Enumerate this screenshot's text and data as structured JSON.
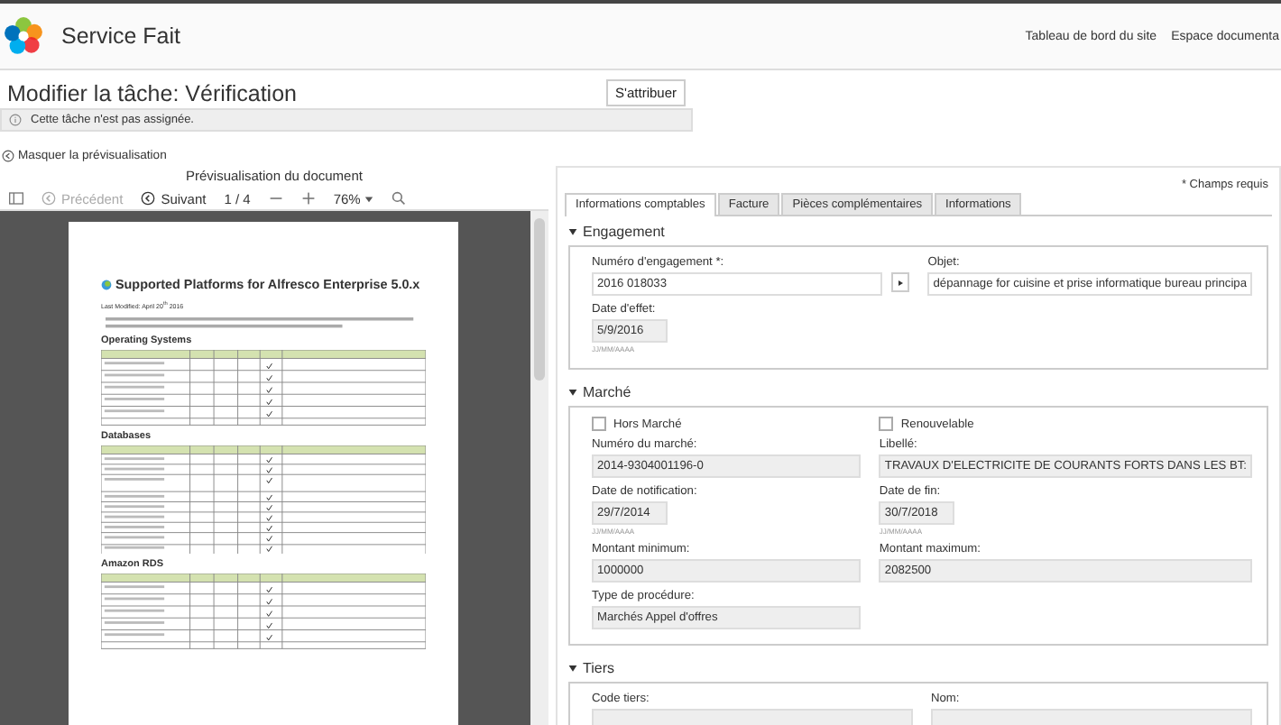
{
  "header": {
    "title": "Service Fait",
    "nav": [
      "Tableau de bord du site",
      "Espace documenta"
    ]
  },
  "task": {
    "title": "Modifier la tâche: Vérification",
    "assign_button": "S'attribuer",
    "notice": "Cette tâche n'est pas assignée."
  },
  "preview_toggle": "Masquer la prévisualisation",
  "preview": {
    "title": "Prévisualisation du document",
    "toolbar": {
      "previous": {
        "label": "Précédent",
        "disabled": true
      },
      "next": {
        "label": "Suivant",
        "disabled": false
      },
      "page": "1 / 4",
      "zoom": "76%"
    },
    "document": {
      "title": "Supported Platforms for Alfresco Enterprise 5.0.x",
      "modified": "Last Modified: April 20$^{th}$ 2016",
      "headings": [
        "Operating Systems",
        "Databases",
        "Amazon RDS"
      ]
    }
  },
  "form": {
    "required_note": "* Champs requis",
    "tabs": [
      {
        "label": "Informations comptables",
        "selected": true
      },
      {
        "label": "Facture",
        "selected": false
      },
      {
        "label": "Pièces complémentaires",
        "selected": false
      },
      {
        "label": "Informations",
        "selected": false
      }
    ],
    "sections": [
      {
        "title": "Engagement",
        "expanded": true,
        "fields": [
          {
            "kind": "lookup",
            "label": "Numéro d'engagement *:",
            "value": "2016 018033"
          },
          {
            "kind": "input",
            "label": "Objet:",
            "value": "dépannage for cuisine et prise informatique bureau principa"
          },
          {
            "kind": "date",
            "label": "Date d'effet:",
            "value": "5/9/2016",
            "hint": "JJ/MM/AAAA"
          }
        ]
      },
      {
        "title": "Marché",
        "expanded": true,
        "fields": [
          {
            "kind": "checkbox",
            "label": "Hors Marché",
            "checked": false
          },
          {
            "kind": "checkbox",
            "label": "Renouvelable",
            "checked": false
          },
          {
            "kind": "readonly",
            "label": "Numéro du marché:",
            "value": "2014-9304001196-0"
          },
          {
            "kind": "readonly",
            "label": "Libellé:",
            "value": "TRAVAUX D'ELECTRICITE DE COURANTS FORTS DANS LES BT:"
          },
          {
            "kind": "date",
            "label": "Date de notification:",
            "value": "29/7/2014",
            "hint": "JJ/MM/AAAA"
          },
          {
            "kind": "date",
            "label": "Date de fin:",
            "value": "30/7/2018",
            "hint": "JJ/MM/AAAA"
          },
          {
            "kind": "readonly",
            "label": "Montant minimum:",
            "value": "1000000"
          },
          {
            "kind": "readonly",
            "label": "Montant maximum:",
            "value": "2082500"
          },
          {
            "kind": "readonly",
            "label": "Type de procédure:",
            "value": "Marchés Appel d'offres"
          }
        ]
      },
      {
        "title": "Tiers",
        "expanded": true,
        "fields": [
          {
            "kind": "readonly",
            "label": "Code tiers:"
          },
          {
            "kind": "readonly",
            "label": "Nom:"
          }
        ]
      }
    ]
  }
}
